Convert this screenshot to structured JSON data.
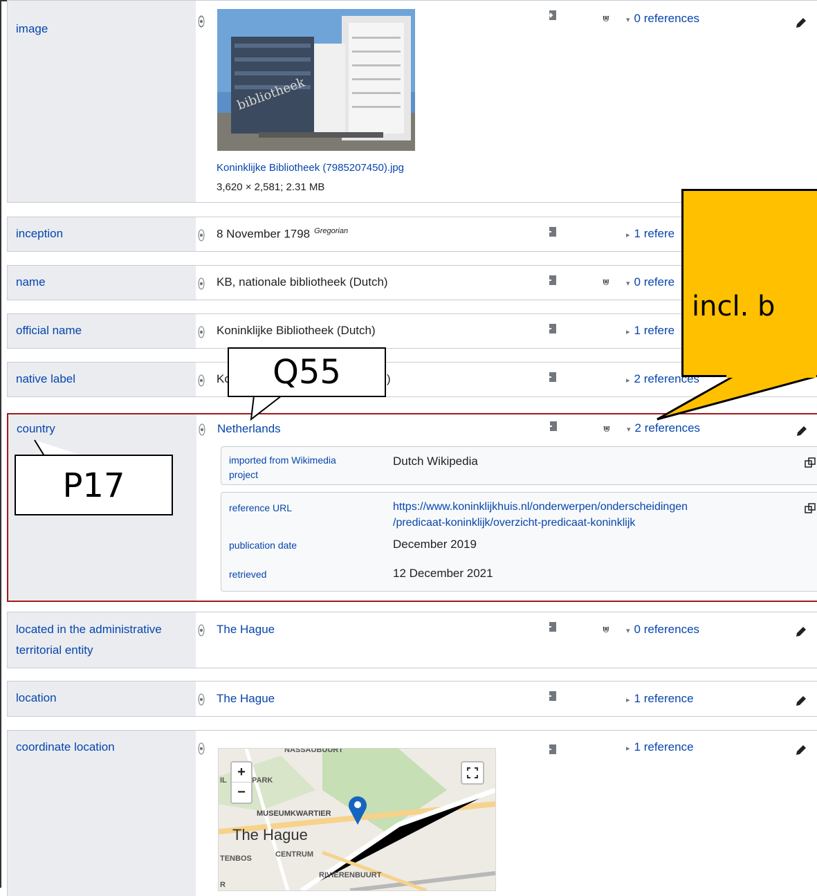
{
  "statements": [
    {
      "property": "image",
      "file_name": "Koninklijke Bibliotheek (7985207450).jpg",
      "file_info": "3,620 × 2,581; 2.31 MB",
      "refs": "0 references"
    },
    {
      "property": "inception",
      "value": "8 November 1798",
      "qualifier": "Gregorian",
      "refs": "1 refere"
    },
    {
      "property": "name",
      "value": "KB, nationale bibliotheek (Dutch)",
      "refs": "0 refere"
    },
    {
      "property": "official name",
      "value": "Koninklijke Bibliotheek (Dutch)",
      "refs": "1 refere"
    },
    {
      "property": "native label",
      "value_prefix": "Ko",
      "value_suffix": ")",
      "refs": "2 references"
    },
    {
      "property": "country",
      "value": "Netherlands",
      "refs": "2 references",
      "references": [
        {
          "rows": [
            {
              "prop": "imported from Wikimedia project",
              "value": "Dutch Wikipedia"
            }
          ]
        },
        {
          "rows": [
            {
              "prop": "reference URL",
              "value_line1": "https://www.koninklijkhuis.nl/onderwerpen/onderscheidingen",
              "value_line2": "/predicaat-koninklijk/overzicht-predicaat-koninklijk"
            },
            {
              "prop": "publication date",
              "value": "December 2019"
            },
            {
              "prop": "retrieved",
              "value": "12 December 2021"
            }
          ]
        }
      ]
    },
    {
      "property": "located in the administrative territorial entity",
      "value": "The Hague",
      "refs": "0 references"
    },
    {
      "property": "location",
      "value": "The Hague",
      "refs": "1 reference"
    },
    {
      "property": "coordinate location",
      "refs": "1 reference",
      "map": {
        "labels": [
          "NASSAUBUURT",
          "PARK",
          "MUSEUMKWARTIER",
          "The Hague",
          "CENTRUM",
          "RIVIERENBUURT",
          "TENBOS",
          "IL",
          "R"
        ],
        "zoom_in": "+",
        "zoom_out": "−"
      }
    }
  ],
  "callouts": {
    "q55": "Q55",
    "p17": "P17",
    "yellow": "incl. b"
  },
  "colors": {
    "link": "#0645ad",
    "highlight_border": "#a2191b",
    "callout_yellow": "#ffc000"
  }
}
